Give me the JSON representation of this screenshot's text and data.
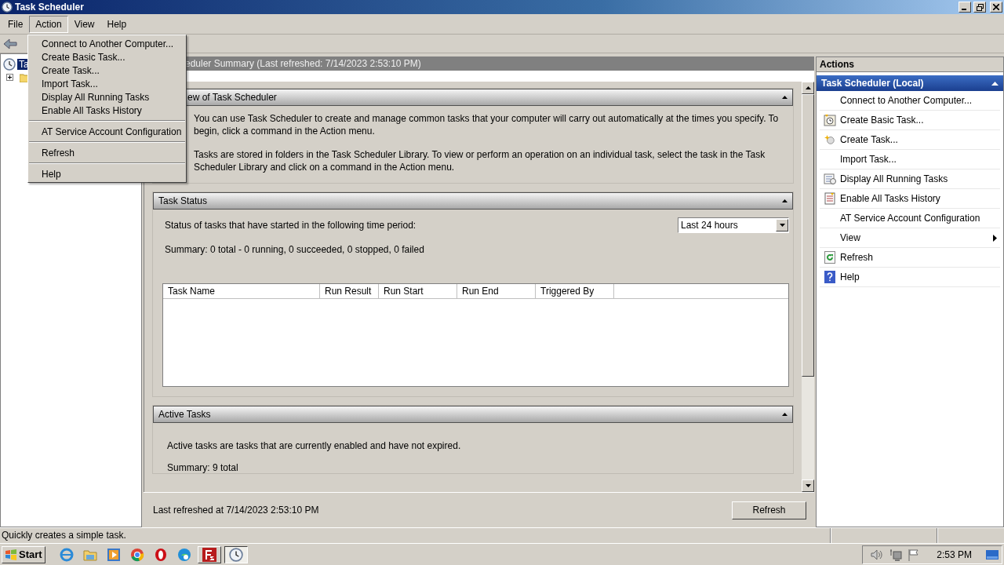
{
  "window": {
    "title": "Task Scheduler"
  },
  "menu_bar": [
    {
      "label": "File",
      "selected": false
    },
    {
      "label": "Action",
      "selected": true
    },
    {
      "label": "View",
      "selected": false
    },
    {
      "label": "Help",
      "selected": false
    }
  ],
  "action_menu": [
    {
      "items": [
        "Connect to Another Computer...",
        "Create Basic Task...",
        "Create Task...",
        "Import Task...",
        "Display All Running Tasks",
        "Enable All Tasks History"
      ]
    },
    {
      "items": [
        "AT Service Account Configuration"
      ]
    },
    {
      "items": [
        "Refresh"
      ]
    },
    {
      "items": [
        "Help"
      ]
    }
  ],
  "tree": [
    {
      "label": "Ta",
      "selected": true
    }
  ],
  "summary": {
    "header": "eduler Summary (Last refreshed: 7/14/2023 2:53:10 PM)",
    "overview": {
      "title": "ew of Task Scheduler",
      "paragraphs": [
        "You can use Task Scheduler to create and manage common tasks that your computer will carry out automatically at the times you specify. To begin, click a command in the Action menu.",
        "Tasks are stored in folders in the Task Scheduler Library. To view or perform an operation on an individual task, select the task in the Task Scheduler Library and click on a command in the Action menu."
      ]
    },
    "task_status": {
      "title": "Task Status",
      "period_label": "Status of tasks that have started in the following time period:",
      "period": "Last 24 hours",
      "summary": "Summary: 0 total - 0 running, 0 succeeded, 0 stopped, 0 failed",
      "columns": [
        "Task Name",
        "Run Result",
        "Run Start",
        "Run End",
        "Triggered By"
      ]
    },
    "active_tasks": {
      "title": "Active Tasks",
      "description": "Active tasks are tasks that are currently enabled and have not expired.",
      "summary": "Summary: 9 total"
    },
    "last_refreshed": "Last refreshed at 7/14/2023 2:53:10 PM",
    "refresh_button": "Refresh"
  },
  "actions": {
    "title": "Actions",
    "section": "Task Scheduler (Local)",
    "items": [
      {
        "label": "Connect to Another Computer...",
        "kind": "plain"
      },
      {
        "label": "Create Basic Task...",
        "kind": "basic-task"
      },
      {
        "label": "Create Task...",
        "kind": "task"
      },
      {
        "label": "Import Task...",
        "kind": "plain"
      },
      {
        "label": "Display All Running Tasks",
        "kind": "running"
      },
      {
        "label": "Enable All Tasks History",
        "kind": "history"
      },
      {
        "label": "AT Service Account Configuration",
        "kind": "plain"
      },
      {
        "label": "View",
        "kind": "submenu"
      },
      {
        "label": "Refresh",
        "kind": "refresh"
      },
      {
        "label": "Help",
        "kind": "help"
      }
    ]
  },
  "status_bar": "Quickly creates a simple task.",
  "taskbar": {
    "start": "Start",
    "windows": [
      {
        "kind": "filezilla",
        "selected": false
      },
      {
        "kind": "scheduler",
        "selected": true
      }
    ],
    "clock": "2:53 PM"
  }
}
